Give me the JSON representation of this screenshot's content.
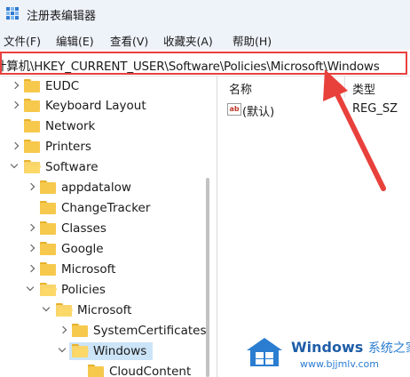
{
  "window": {
    "title": "注册表编辑器"
  },
  "menu": [
    "文件(F)",
    "编辑(E)",
    "查看(V)",
    "收藏夹(A)",
    "帮助(H)"
  ],
  "address": {
    "path": "计算机\\HKEY_CURRENT_USER\\Software\\Policies\\Microsoft\\Windows"
  },
  "tree": [
    {
      "label": "EUDC",
      "expander": "collapsed"
    },
    {
      "label": "Keyboard Layout",
      "expander": "collapsed"
    },
    {
      "label": "Network",
      "expander": "none"
    },
    {
      "label": "Printers",
      "expander": "collapsed"
    },
    {
      "label": "Software",
      "expander": "expanded"
    },
    {
      "label": "appdatalow",
      "expander": "collapsed"
    },
    {
      "label": "ChangeTracker",
      "expander": "none"
    },
    {
      "label": "Classes",
      "expander": "collapsed"
    },
    {
      "label": "Google",
      "expander": "collapsed"
    },
    {
      "label": "Microsoft",
      "expander": "collapsed"
    },
    {
      "label": "Policies",
      "expander": "expanded"
    },
    {
      "label": "Microsoft",
      "expander": "expanded"
    },
    {
      "label": "SystemCertificates",
      "expander": "collapsed"
    },
    {
      "label": "Windows",
      "expander": "expanded",
      "selected": true
    },
    {
      "label": "CloudContent",
      "expander": "none"
    }
  ],
  "values_pane": {
    "headers": {
      "name": "名称",
      "type": "类型"
    },
    "rows": [
      {
        "icon": "string-value-icon",
        "icon_text": "ab",
        "name": "(默认)",
        "type": "REG_SZ"
      }
    ]
  },
  "annotation": {
    "color": "#e8413c",
    "icon": "red-arrow"
  },
  "watermark": {
    "brand": "Windows",
    "brand_cn": "系统之家",
    "url": "www.bjjmlv.com"
  }
}
